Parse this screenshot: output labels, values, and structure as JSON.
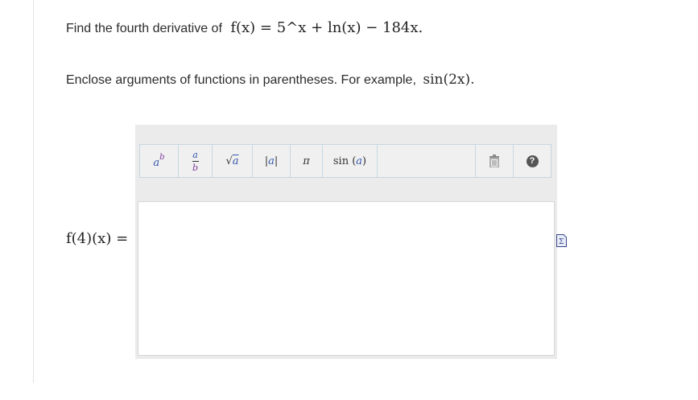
{
  "question": {
    "prefix": "Find the fourth derivative of",
    "function_latex": "f(x) = 5^x + ln(x) − 184x."
  },
  "instruction": {
    "text": "Enclose arguments of functions in parentheses. For example,",
    "example": "sin(2x)."
  },
  "toolbar": {
    "buttons": [
      {
        "name": "superscript",
        "label": "a^b"
      },
      {
        "name": "fraction",
        "label": "a/b"
      },
      {
        "name": "sqrt",
        "label": "√a"
      },
      {
        "name": "abs",
        "label": "|a|"
      },
      {
        "name": "pi",
        "label": "π"
      },
      {
        "name": "sin",
        "label": "sin(a)"
      }
    ],
    "trash_icon": "trash-icon",
    "help_icon": "help-icon"
  },
  "answer": {
    "label": "f(4)(x) =",
    "value": ""
  },
  "colors": {
    "panel_bg": "#ebebeb",
    "toolbar_border": "#c6d7e3",
    "variable_blue": "#3355aa",
    "variable_purple": "#7a3a9a"
  }
}
